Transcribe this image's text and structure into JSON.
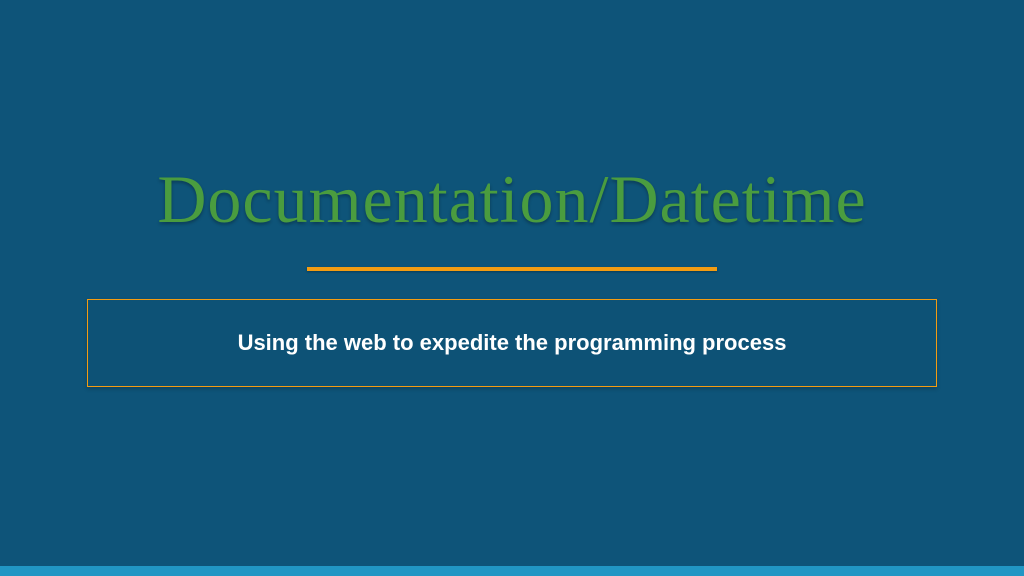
{
  "slide": {
    "title": "Documentation/Datetime",
    "subtitle": "Using the web to expedite the programming process"
  },
  "colors": {
    "background": "#0e5479",
    "title": "#4a9c3f",
    "accent": "#f39c12",
    "bottomBar": "#2196c4",
    "subtitleText": "#ffffff"
  }
}
